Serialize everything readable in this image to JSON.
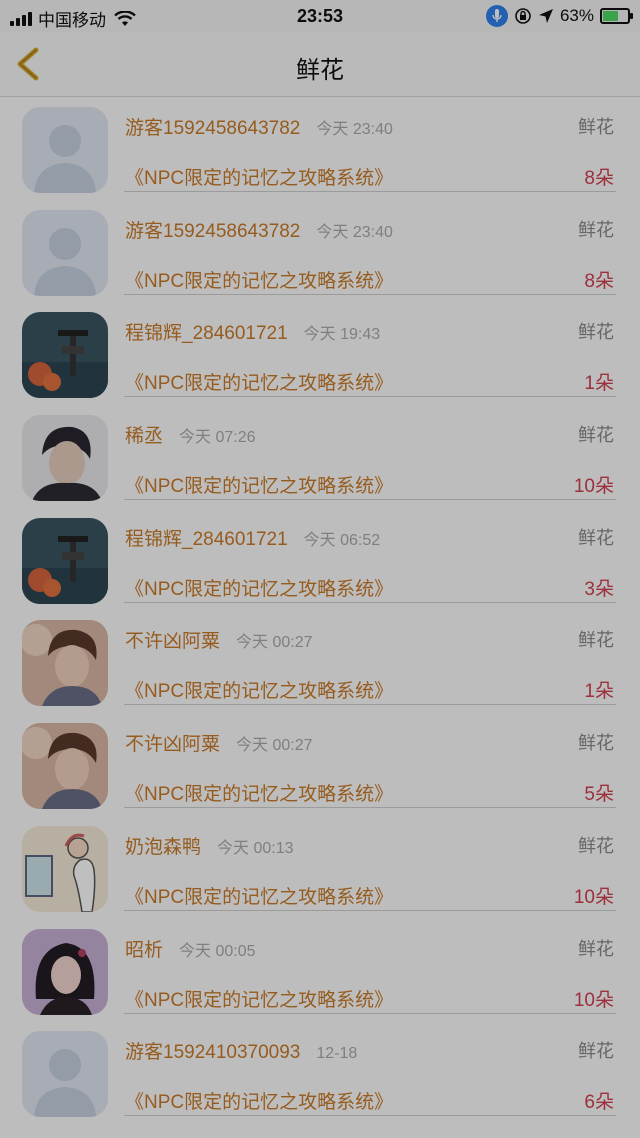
{
  "status_bar": {
    "carrier": "中国移动",
    "time": "23:53",
    "battery_percent": "63%",
    "battery_level": 0.63,
    "icons": [
      "signal-icon",
      "wifi-icon",
      "microphone-icon",
      "rotation-lock-icon",
      "location-arrow-icon",
      "battery-charging-icon"
    ]
  },
  "nav": {
    "title": "鲜花",
    "back_icon": "chevron-left-icon",
    "accent": "#d4a72c"
  },
  "rows": [
    {
      "avatar": "default",
      "name": "游客1592458643782",
      "time": "今天 23:40",
      "gift": "鲜花",
      "book": "《NPC限定的记忆之攻略系统》",
      "count": "8朵"
    },
    {
      "avatar": "default",
      "name": "游客1592458643782",
      "time": "今天 23:40",
      "gift": "鲜花",
      "book": "《NPC限定的记忆之攻略系统》",
      "count": "8朵"
    },
    {
      "avatar": "scene",
      "name": "程锦辉_284601721",
      "time": "今天 19:43",
      "gift": "鲜花",
      "book": "《NPC限定的记忆之攻略系统》",
      "count": "1朵"
    },
    {
      "avatar": "portrait-dark",
      "name": "稀丞",
      "time": "今天 07:26",
      "gift": "鲜花",
      "book": "《NPC限定的记忆之攻略系统》",
      "count": "10朵"
    },
    {
      "avatar": "scene",
      "name": "程锦辉_284601721",
      "time": "今天 06:52",
      "gift": "鲜花",
      "book": "《NPC限定的记忆之攻略系统》",
      "count": "3朵"
    },
    {
      "avatar": "portrait-warm",
      "name": "不许凶阿粟",
      "time": "今天 00:27",
      "gift": "鲜花",
      "book": "《NPC限定的记忆之攻略系统》",
      "count": "1朵"
    },
    {
      "avatar": "portrait-warm",
      "name": "不许凶阿粟",
      "time": "今天 00:27",
      "gift": "鲜花",
      "book": "《NPC限定的记忆之攻略系统》",
      "count": "5朵"
    },
    {
      "avatar": "illustration",
      "name": "奶泡森鸭",
      "time": "今天 00:13",
      "gift": "鲜花",
      "book": "《NPC限定的记忆之攻略系统》",
      "count": "10朵"
    },
    {
      "avatar": "portrait-purple",
      "name": "昭析",
      "time": "今天 00:05",
      "gift": "鲜花",
      "book": "《NPC限定的记忆之攻略系统》",
      "count": "10朵"
    },
    {
      "avatar": "default",
      "name": "游客1592410370093",
      "time": "12-18",
      "gift": "鲜花",
      "book": "《NPC限定的记忆之攻略系统》",
      "count": "6朵"
    }
  ]
}
